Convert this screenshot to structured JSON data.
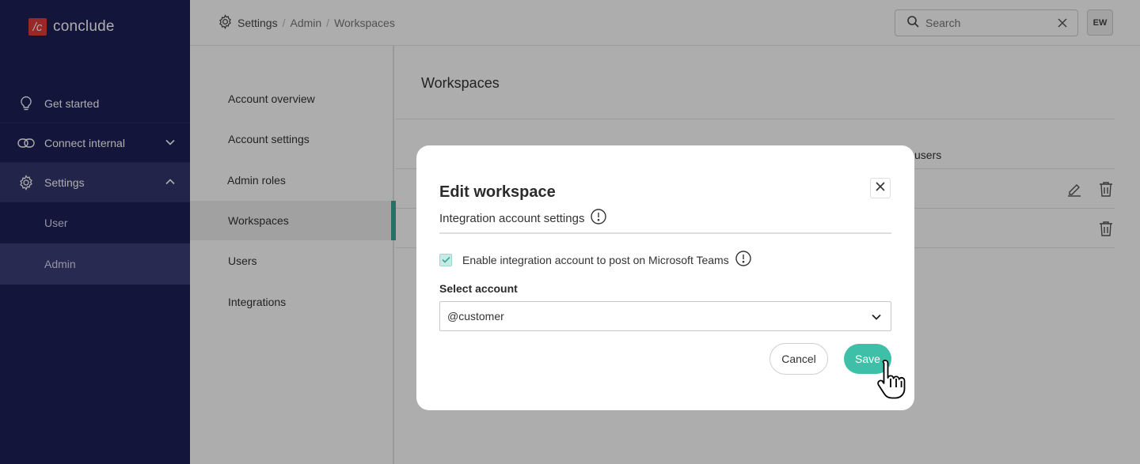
{
  "brand": {
    "logo_mark": "/c",
    "name": "conclude",
    "accent": "#e23b3b"
  },
  "sidebar": {
    "items": [
      {
        "label": "Get started",
        "icon": "lightbulb-icon"
      },
      {
        "label": "Connect internal",
        "icon": "link-icon",
        "expanded": false
      },
      {
        "label": "Settings",
        "icon": "gear-icon",
        "expanded": true
      }
    ],
    "sub_items": [
      {
        "label": "User"
      },
      {
        "label": "Admin"
      }
    ]
  },
  "header": {
    "breadcrumb": [
      "Settings",
      "Admin",
      "Workspaces"
    ],
    "search_placeholder": "Search",
    "avatar_initials": "EW"
  },
  "settings_menu": {
    "items": [
      "Account overview",
      "Account settings",
      "Admin roles",
      "Workspaces",
      "Users",
      "Integrations"
    ],
    "active": "Workspaces"
  },
  "main": {
    "title": "Workspaces",
    "table_header_partial": "users"
  },
  "modal": {
    "title": "Edit workspace",
    "subtitle": "Integration account settings",
    "checkbox_label": "Enable integration account to post on Microsoft Teams",
    "checkbox_checked": true,
    "select_label": "Select account",
    "select_value": "@customer",
    "cancel_label": "Cancel",
    "save_label": "Save"
  },
  "colors": {
    "sidebar_bg": "#1c1f57",
    "primary": "#3dbfa8",
    "active_indicator": "#3aa596"
  }
}
